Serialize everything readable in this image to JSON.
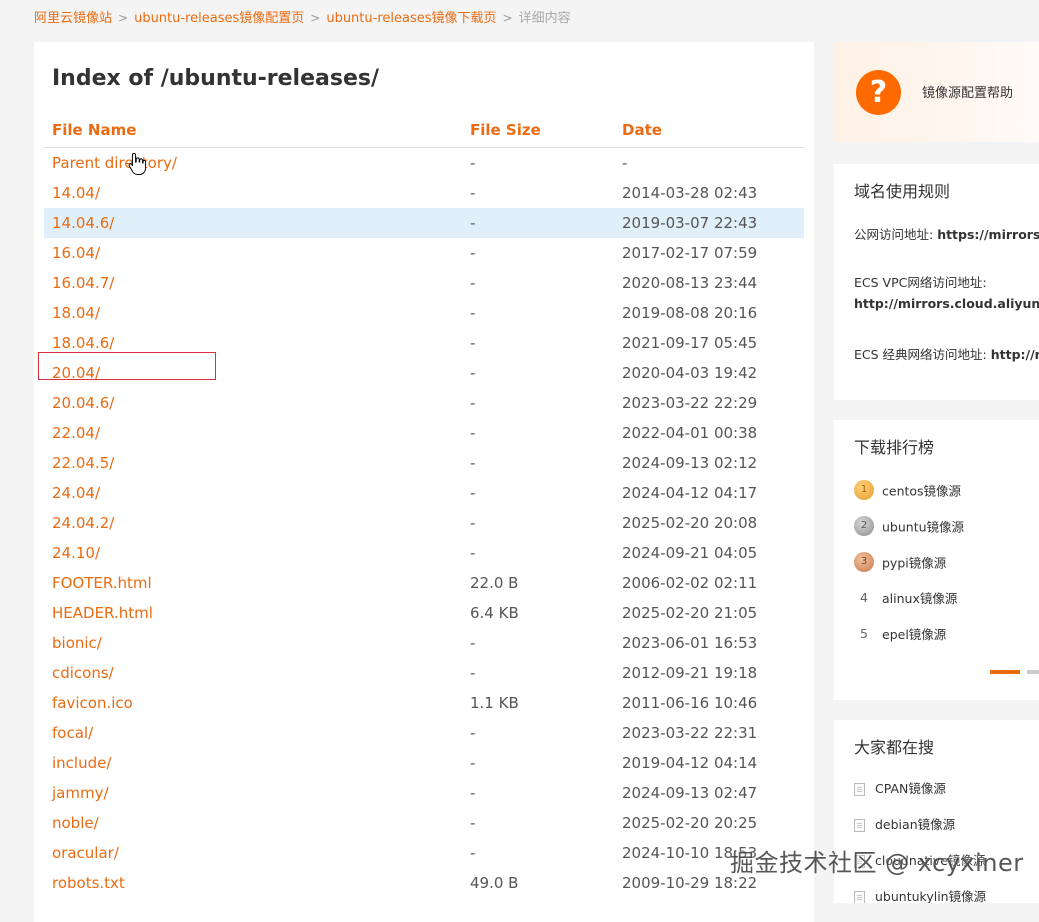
{
  "breadcrumb": {
    "items": [
      "阿里云镜像站",
      "ubuntu-releases镜像配置页",
      "ubuntu-releases镜像下载页"
    ],
    "current": "详细内容",
    "separator": ">"
  },
  "listing": {
    "title": "Index of /ubuntu-releases/",
    "headers": {
      "name": "File Name",
      "size": "File Size",
      "date": "Date"
    },
    "rows": [
      {
        "name": "Parent directory/",
        "size": "-",
        "date": "-"
      },
      {
        "name": "14.04/",
        "size": "-",
        "date": "2014-03-28 02:43"
      },
      {
        "name": "14.04.6/",
        "size": "-",
        "date": "2019-03-07 22:43"
      },
      {
        "name": "16.04/",
        "size": "-",
        "date": "2017-02-17 07:59"
      },
      {
        "name": "16.04.7/",
        "size": "-",
        "date": "2020-08-13 23:44"
      },
      {
        "name": "18.04/",
        "size": "-",
        "date": "2019-08-08 20:16"
      },
      {
        "name": "18.04.6/",
        "size": "-",
        "date": "2021-09-17 05:45"
      },
      {
        "name": "20.04/",
        "size": "-",
        "date": "2020-04-03 19:42"
      },
      {
        "name": "20.04.6/",
        "size": "-",
        "date": "2023-03-22 22:29"
      },
      {
        "name": "22.04/",
        "size": "-",
        "date": "2022-04-01 00:38"
      },
      {
        "name": "22.04.5/",
        "size": "-",
        "date": "2024-09-13 02:12"
      },
      {
        "name": "24.04/",
        "size": "-",
        "date": "2024-04-12 04:17"
      },
      {
        "name": "24.04.2/",
        "size": "-",
        "date": "2025-02-20 20:08"
      },
      {
        "name": "24.10/",
        "size": "-",
        "date": "2024-09-21 04:05"
      },
      {
        "name": "FOOTER.html",
        "size": "22.0 B",
        "date": "2006-02-02 02:11"
      },
      {
        "name": "HEADER.html",
        "size": "6.4 KB",
        "date": "2025-02-20 21:05"
      },
      {
        "name": "bionic/",
        "size": "-",
        "date": "2023-06-01 16:53"
      },
      {
        "name": "cdicons/",
        "size": "-",
        "date": "2012-09-21 19:18"
      },
      {
        "name": "favicon.ico",
        "size": "1.1 KB",
        "date": "2011-06-16 10:46"
      },
      {
        "name": "focal/",
        "size": "-",
        "date": "2023-03-22 22:31"
      },
      {
        "name": "include/",
        "size": "-",
        "date": "2019-04-12 04:14"
      },
      {
        "name": "jammy/",
        "size": "-",
        "date": "2024-09-13 02:47"
      },
      {
        "name": "noble/",
        "size": "-",
        "date": "2025-02-20 20:25"
      },
      {
        "name": "oracular/",
        "size": "-",
        "date": "2024-10-10 18:53"
      },
      {
        "name": "robots.txt",
        "size": "49.0 B",
        "date": "2009-10-29 18:22"
      }
    ]
  },
  "help": {
    "icon": "question-icon",
    "glyph": "?",
    "label": "镜像源配置帮助"
  },
  "domain_rules": {
    "title": "域名使用规则",
    "public_label": "公网访问地址: ",
    "public_url": "https://mirrors.aliyun.com",
    "vpc_label": "ECS VPC网络访问地址:",
    "vpc_url": "http://mirrors.cloud.aliyuncs.com",
    "classic_label": "ECS 经典网络访问地址: ",
    "classic_url": "http://mirrors.aliyuncs.com"
  },
  "ranking": {
    "title": "下载排行榜",
    "items": [
      {
        "rank": "1",
        "label": "centos镜像源"
      },
      {
        "rank": "2",
        "label": "ubuntu镜像源"
      },
      {
        "rank": "3",
        "label": "pypi镜像源"
      },
      {
        "rank": "4",
        "label": "alinux镜像源"
      },
      {
        "rank": "5",
        "label": "epel镜像源"
      }
    ]
  },
  "popular": {
    "title": "大家都在搜",
    "items": [
      "CPAN镜像源",
      "debian镜像源",
      "cloudnative镜像源",
      "ubuntukylin镜像源"
    ]
  },
  "watermark": "掘金技术社区 @ xcyxiner",
  "colors": {
    "accent": "#ea6b12",
    "highlight_row": "#dff0fa",
    "annotation_box": "#d9323b",
    "help_orange": "#ff6a00"
  }
}
